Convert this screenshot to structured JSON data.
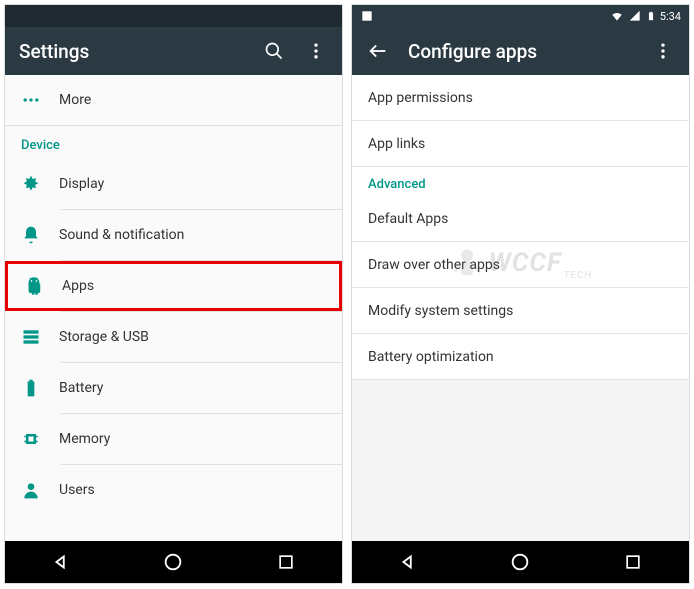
{
  "left": {
    "appbar_title": "Settings",
    "items": {
      "more": "More",
      "section_device": "Device",
      "display": "Display",
      "sound": "Sound & notification",
      "apps": "Apps",
      "storage": "Storage & USB",
      "battery": "Battery",
      "memory": "Memory",
      "users": "Users"
    }
  },
  "right": {
    "status_time": "5:34",
    "appbar_title": "Configure apps",
    "items": {
      "perms": "App permissions",
      "links": "App links",
      "section_advanced": "Advanced",
      "default": "Default Apps",
      "draw": "Draw over other apps",
      "modify": "Modify system settings",
      "battery_opt": "Battery optimization"
    }
  },
  "watermark": "WCCF",
  "watermark_sub": "TECH"
}
